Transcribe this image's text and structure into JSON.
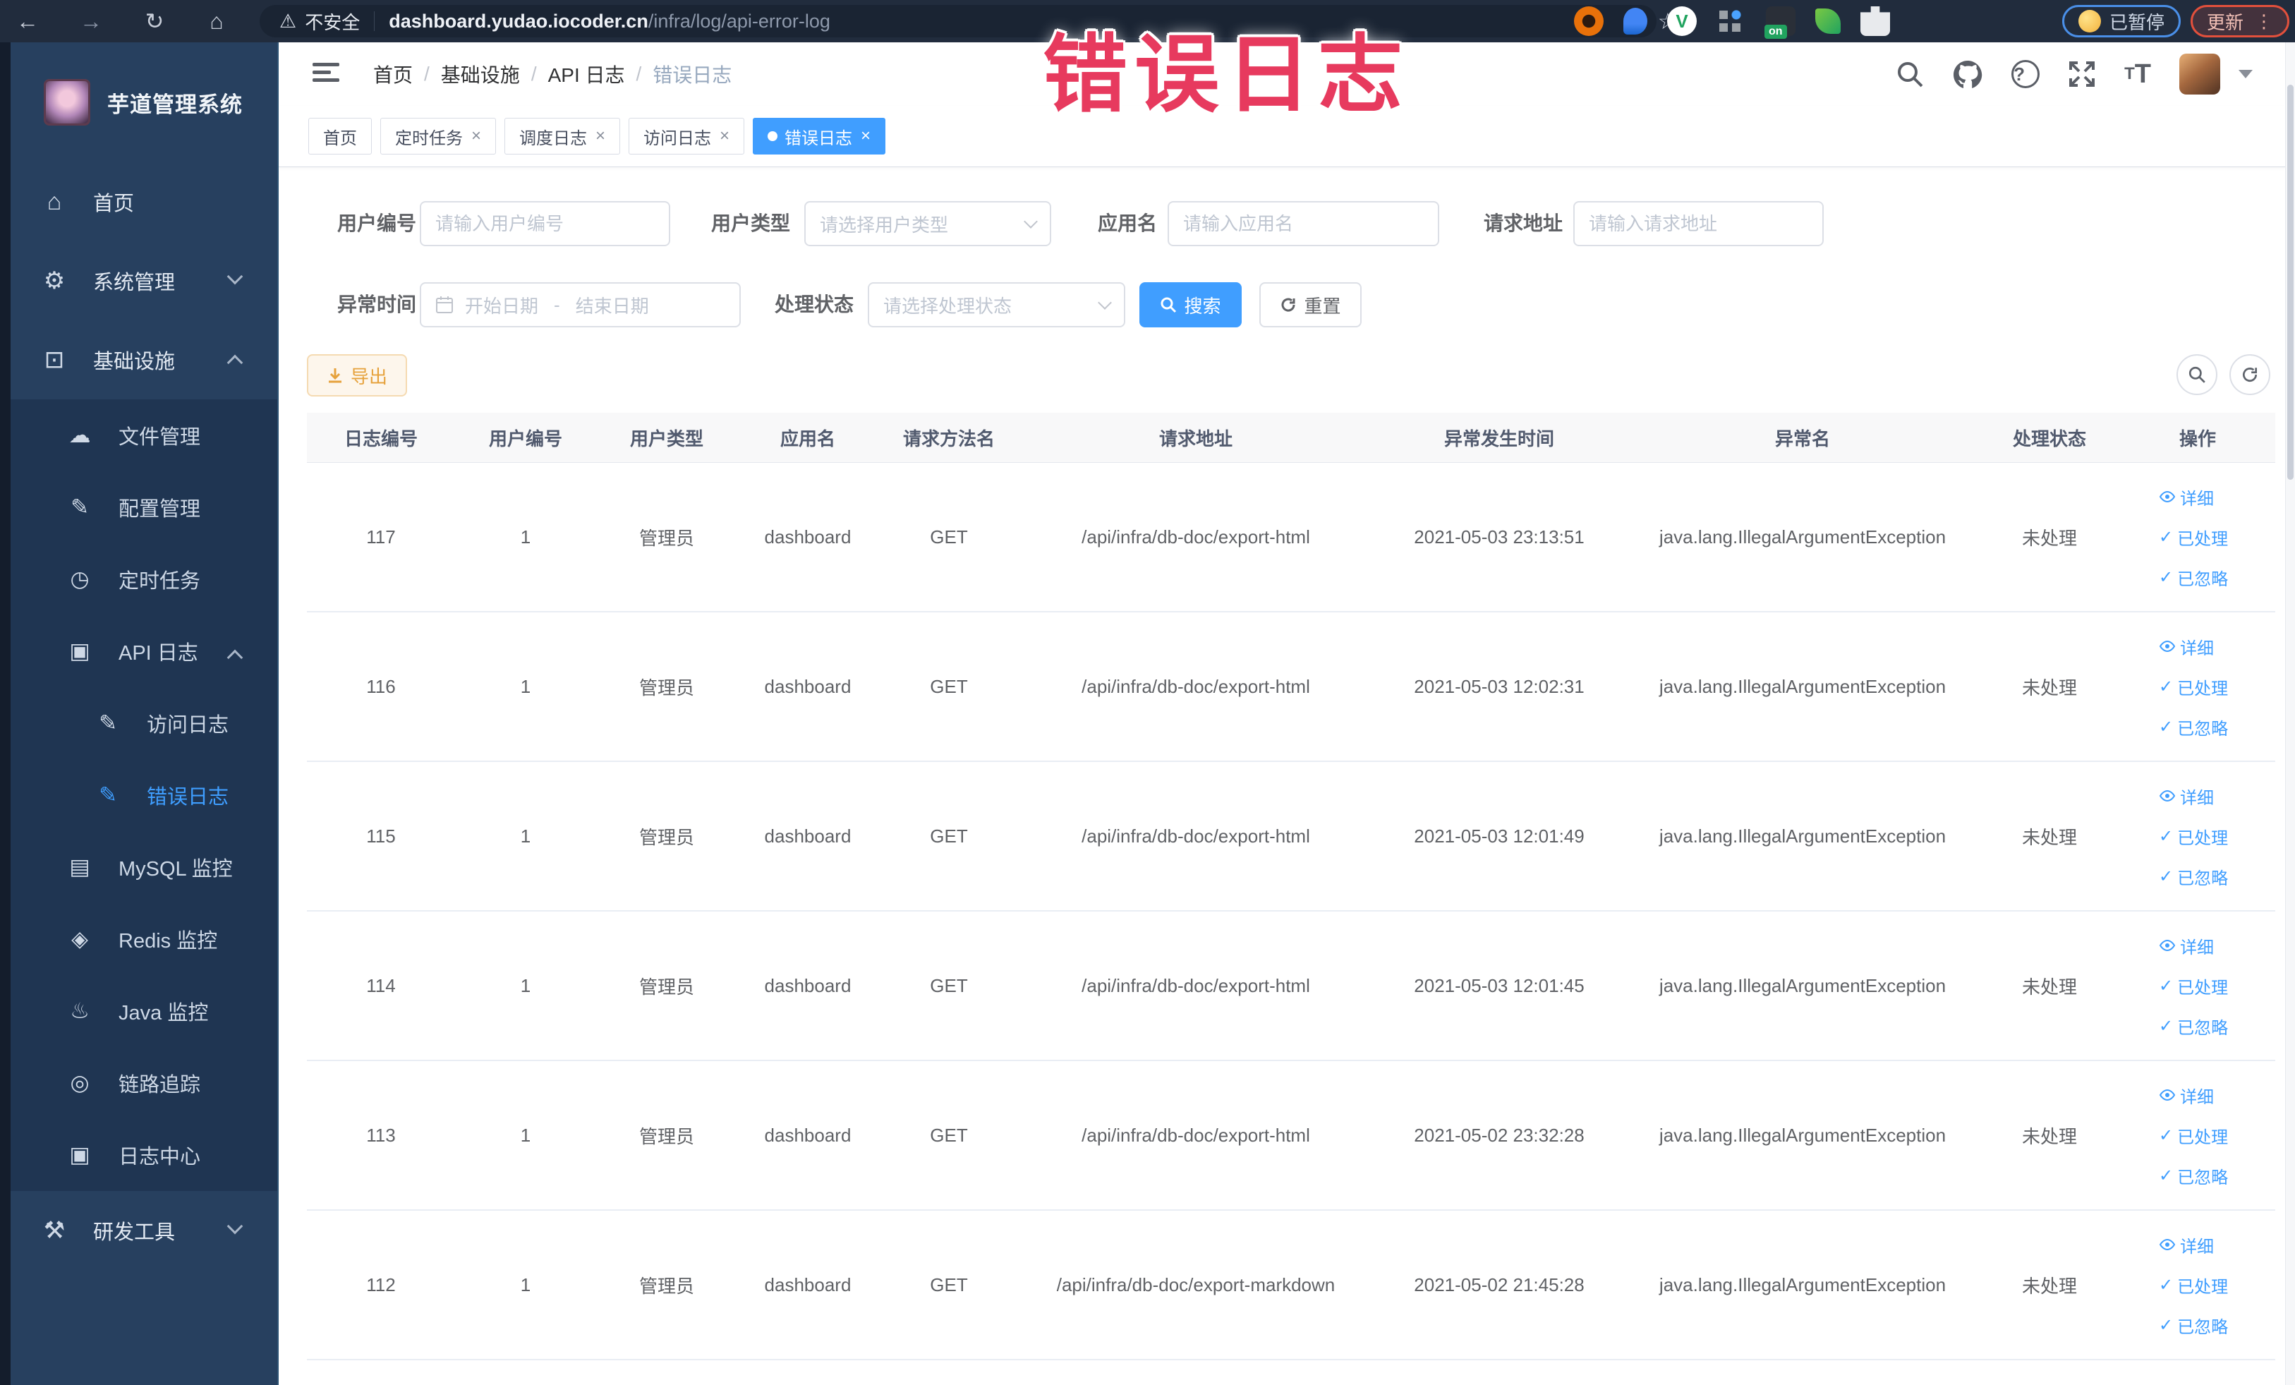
{
  "colors": {
    "accent": "#409eff",
    "warning": "#e6a23c",
    "overlay_pink": "#e73a5e",
    "sidebar_bg": "#27405f",
    "submenu_bg": "#1f3552"
  },
  "icons": {
    "back": "←",
    "forward": "→",
    "reload": "↻",
    "home_nav": "⌂",
    "warning_tri": "⚠",
    "star": "☆",
    "dots": "⋮",
    "close": "×",
    "check": "✓",
    "question": "?",
    "t": "T",
    "slash": "/",
    "home": "⌂",
    "gear": "⚙",
    "infra": "⊡",
    "cloud": "☁",
    "pencil": "✎",
    "timer": "◷",
    "apilog": "▣",
    "mysql": "▤",
    "redis": "◈",
    "java": "♨",
    "trace": "◎",
    "logcenter": "▣",
    "devtools": "⚒"
  },
  "browser": {
    "insecure": "不安全",
    "host": "dashboard.yudao.iocoder.cn",
    "path": "/infra/log/api-error-log",
    "paused": "已暂停",
    "update": "更新",
    "ext_on_badge": "on"
  },
  "overlay_title": "错误日志",
  "sidebar": {
    "title": "芋道管理系统",
    "items": [
      {
        "label": "首页"
      },
      {
        "label": "系统管理"
      },
      {
        "label": "基础设施"
      },
      {
        "label": "文件管理"
      },
      {
        "label": "配置管理"
      },
      {
        "label": "定时任务"
      },
      {
        "label": "API 日志"
      },
      {
        "label": "访问日志"
      },
      {
        "label": "错误日志"
      },
      {
        "label": "MySQL 监控"
      },
      {
        "label": "Redis 监控"
      },
      {
        "label": "Java 监控"
      },
      {
        "label": "链路追踪"
      },
      {
        "label": "日志中心"
      },
      {
        "label": "研发工具"
      }
    ]
  },
  "breadcrumb": {
    "items": [
      "首页",
      "基础设施",
      "API 日志",
      "错误日志"
    ]
  },
  "tabs": [
    {
      "label": "首页"
    },
    {
      "label": "定时任务"
    },
    {
      "label": "调度日志"
    },
    {
      "label": "访问日志"
    },
    {
      "label": "错误日志"
    }
  ],
  "filters": {
    "user_id": {
      "label": "用户编号",
      "placeholder": "请输入用户编号"
    },
    "user_type": {
      "label": "用户类型",
      "placeholder": "请选择用户类型"
    },
    "app_name": {
      "label": "应用名",
      "placeholder": "请输入应用名"
    },
    "request_url": {
      "label": "请求地址",
      "placeholder": "请输入请求地址"
    },
    "exception_time": {
      "label": "异常时间",
      "start": "开始日期",
      "separator": "-",
      "end": "结束日期"
    },
    "process_status": {
      "label": "处理状态",
      "placeholder": "请选择处理状态"
    },
    "search": "搜索",
    "reset": "重置",
    "export": "导出"
  },
  "table": {
    "columns": [
      "日志编号",
      "用户编号",
      "用户类型",
      "应用名",
      "请求方法名",
      "请求地址",
      "异常发生时间",
      "异常名",
      "处理状态",
      "操作"
    ],
    "actions": {
      "detail": "详细",
      "processed": "已处理",
      "ignored": "已忽略"
    },
    "rows": [
      {
        "id": "117",
        "user_id": "1",
        "user_type": "管理员",
        "app": "dashboard",
        "method": "GET",
        "url": "/api/infra/db-doc/export-html",
        "time": "2021-05-03 23:13:51",
        "exception": "java.lang.IllegalArgumentException",
        "status": "未处理"
      },
      {
        "id": "116",
        "user_id": "1",
        "user_type": "管理员",
        "app": "dashboard",
        "method": "GET",
        "url": "/api/infra/db-doc/export-html",
        "time": "2021-05-03 12:02:31",
        "exception": "java.lang.IllegalArgumentException",
        "status": "未处理"
      },
      {
        "id": "115",
        "user_id": "1",
        "user_type": "管理员",
        "app": "dashboard",
        "method": "GET",
        "url": "/api/infra/db-doc/export-html",
        "time": "2021-05-03 12:01:49",
        "exception": "java.lang.IllegalArgumentException",
        "status": "未处理"
      },
      {
        "id": "114",
        "user_id": "1",
        "user_type": "管理员",
        "app": "dashboard",
        "method": "GET",
        "url": "/api/infra/db-doc/export-html",
        "time": "2021-05-03 12:01:45",
        "exception": "java.lang.IllegalArgumentException",
        "status": "未处理"
      },
      {
        "id": "113",
        "user_id": "1",
        "user_type": "管理员",
        "app": "dashboard",
        "method": "GET",
        "url": "/api/infra/db-doc/export-html",
        "time": "2021-05-02 23:32:28",
        "exception": "java.lang.IllegalArgumentException",
        "status": "未处理"
      },
      {
        "id": "112",
        "user_id": "1",
        "user_type": "管理员",
        "app": "dashboard",
        "method": "GET",
        "url": "/api/infra/db-doc/export-markdown",
        "time": "2021-05-02 21:45:28",
        "exception": "java.lang.IllegalArgumentException",
        "status": "未处理"
      }
    ]
  }
}
